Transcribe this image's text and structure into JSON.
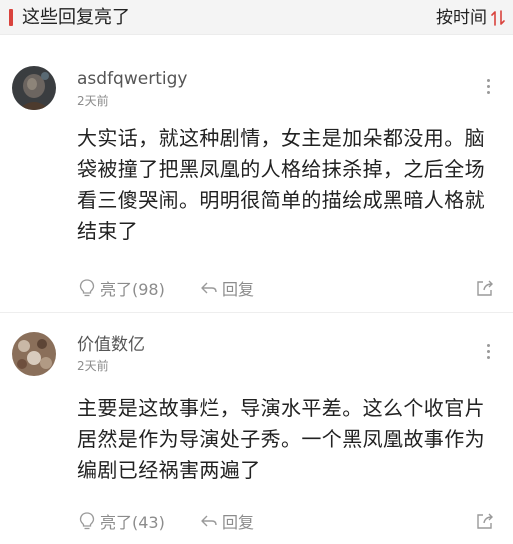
{
  "header": {
    "title": "这些回复亮了",
    "sort_label": "按时间"
  },
  "comments": [
    {
      "username": "asdfqwertigy",
      "time": "2天前",
      "text": "大实话，就这种剧情，女主是加朵都没用。脑袋被撞了把黑凤凰的人格给抹杀掉，之后全场看三傻哭闹。明明很简单的描绘成黑暗人格就结束了",
      "like_label": "亮了(98)",
      "reply_label": "回复"
    },
    {
      "username": "价值数亿",
      "time": "2天前",
      "text": "主要是这故事烂，导演水平差。这么个收官片居然是作为导演处子秀。一个黑凤凰故事作为编剧已经祸害两遍了",
      "like_label": "亮了(43)",
      "reply_label": "回复"
    }
  ],
  "colors": {
    "accent": "#d9433d",
    "header_bg": "#f4f4f4",
    "muted_text": "#8c8c8c"
  }
}
